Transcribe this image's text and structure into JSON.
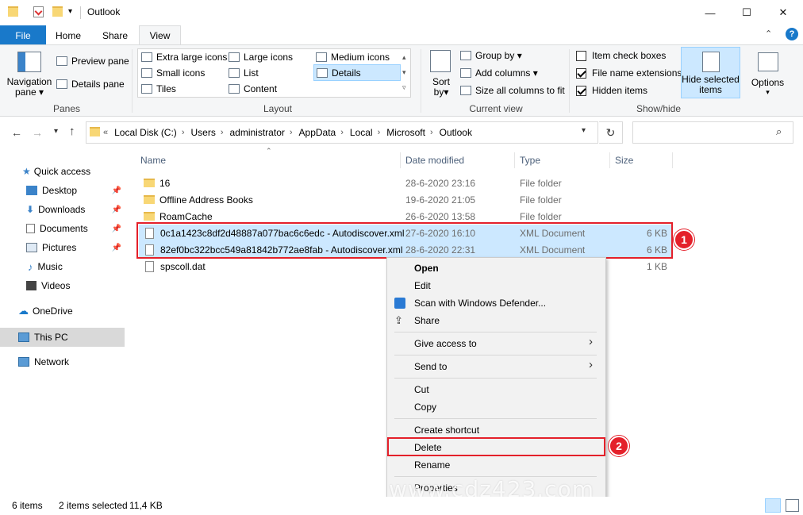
{
  "window": {
    "title": "Outlook",
    "minimize_glyph": "—",
    "maximize_glyph": "☐",
    "close_glyph": "✕",
    "help_glyph": "?"
  },
  "ribbon_tabs": [
    {
      "label": "File"
    },
    {
      "label": "Home"
    },
    {
      "label": "Share"
    },
    {
      "label": "View"
    }
  ],
  "panes": {
    "label": "Panes",
    "navigation_pane": "Navigation\npane",
    "preview_pane": "Preview pane",
    "details_pane": "Details pane"
  },
  "layout": {
    "label": "Layout",
    "items": [
      "Extra large icons",
      "Large icons",
      "Medium icons",
      "Small icons",
      "List",
      "Details",
      "Tiles",
      "Content"
    ]
  },
  "current_view": {
    "label": "Current view",
    "sort_by": "Sort\nby",
    "group_by": "Group by",
    "add_columns": "Add columns",
    "size_all_columns": "Size all columns to fit"
  },
  "show_hide": {
    "label": "Show/hide",
    "item_check_boxes": "Item check boxes",
    "file_name_extensions": "File name extensions",
    "hidden_items": "Hidden items",
    "hide_selected_items": "Hide selected\nitems",
    "options": "Options"
  },
  "address": {
    "crumbs": [
      "Local Disk (C:)",
      "Users",
      "administrator",
      "AppData",
      "Local",
      "Microsoft",
      "Outlook"
    ]
  },
  "nav": {
    "quick_access": "Quick access",
    "items": [
      "Desktop",
      "Downloads",
      "Documents",
      "Pictures",
      "Music",
      "Videos"
    ],
    "onedrive": "OneDrive",
    "this_pc": "This PC",
    "network": "Network"
  },
  "columns": {
    "name": "Name",
    "date": "Date modified",
    "type": "Type",
    "size": "Size"
  },
  "files": [
    {
      "name": "16",
      "date": "28-6-2020 23:16",
      "type": "File folder",
      "size": ""
    },
    {
      "name": "Offline Address Books",
      "date": "19-6-2020 21:05",
      "type": "File folder",
      "size": ""
    },
    {
      "name": "RoamCache",
      "date": "26-6-2020 13:58",
      "type": "File folder",
      "size": ""
    },
    {
      "name": "0c1a1423c8df2d48887a077bac6c6edc - Autodiscover.xml",
      "date": "27-6-2020 16:10",
      "type": "XML Document",
      "size": "6 KB"
    },
    {
      "name": "82ef0bc322bcc549a81842b772ae8fab - Autodiscover.xml",
      "date": "28-6-2020 22:31",
      "type": "XML Document",
      "size": "6 KB"
    },
    {
      "name": "spscoll.dat",
      "date": "",
      "type": "",
      "size": "1 KB"
    }
  ],
  "context_menu": {
    "open": "Open",
    "edit": "Edit",
    "scan": "Scan with Windows Defender...",
    "share": "Share",
    "give_access": "Give access to",
    "send_to": "Send to",
    "cut": "Cut",
    "copy": "Copy",
    "create_shortcut": "Create shortcut",
    "delete": "Delete",
    "rename": "Rename",
    "properties": "Properties"
  },
  "badges": {
    "one": "1",
    "two": "2"
  },
  "status": {
    "items": "6 items",
    "selected": "2 items selected",
    "size": "11,4 KB"
  },
  "watermark": "www.cdz423.com",
  "colors": {
    "accent": "#1979ca",
    "selection": "#cce8ff",
    "highlight_red": "#e4202a"
  }
}
